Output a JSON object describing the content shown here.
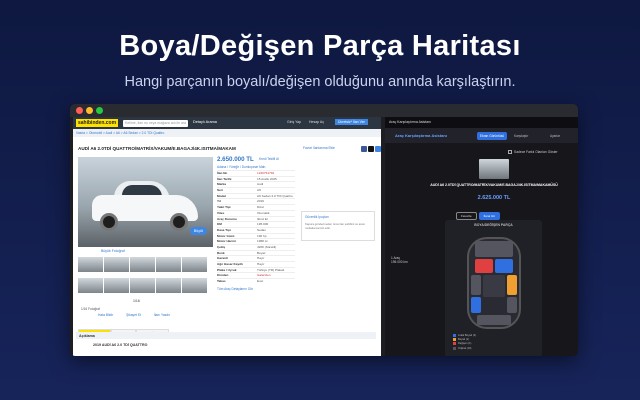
{
  "hero": {
    "title": "Boya/Değişen Parça Haritası",
    "subtitle": "Hangi parçanın boyalı/değişen olduğunu anında karşılaştırın."
  },
  "listing": {
    "logo": "sahibinden.com",
    "search_placeholder": "Kelime, ilan no veya mağaza adı ile ara",
    "detailed_search": "Detaylı Arama",
    "top_links": [
      "Giriş Yap",
      "Hesap Aç"
    ],
    "post_ad": "Ücretsiz* İlan Ver",
    "breadcrumb": "Vasıta > Otomobil > Audi > A6 > A6 Sedan > 2.0 TDI Quattro",
    "title": "AUDİ A6 2.0TDİ QUATTRO/MATRİX/VAKUM/E.BAGAJ/4K.ISITMA/MAKAM",
    "actions": "Favori İlanlarıma Ekle",
    "price": "2.650.000 TL",
    "price_link": "Kredi Teklifi Al",
    "location": "Adana / Yüreğir / Dumlupınar Mah.",
    "details": [
      {
        "k": "İlan No",
        "v": "1240751792",
        "red": true
      },
      {
        "k": "İlan Tarihi",
        "v": "15 Aralık 2025"
      },
      {
        "k": "Marka",
        "v": "Audi"
      },
      {
        "k": "Seri",
        "v": "A6"
      },
      {
        "k": "Model",
        "v": "A6 Sedan 2.0 TDI Quattro"
      },
      {
        "k": "Yıl",
        "v": "2019"
      },
      {
        "k": "Yakıt Tipi",
        "v": "Dizel"
      },
      {
        "k": "Vites",
        "v": "Otomatik"
      },
      {
        "k": "Araç Durumu",
        "v": "İkinci El"
      },
      {
        "k": "KM",
        "v": "195.000"
      },
      {
        "k": "Kasa Tipi",
        "v": "Sedan"
      },
      {
        "k": "Motor Gücü",
        "v": "190 hp"
      },
      {
        "k": "Motor Hacmi",
        "v": "1968 cc"
      },
      {
        "k": "Çekiş",
        "v": "4WD (Sürekli)"
      },
      {
        "k": "Renk",
        "v": "Beyaz"
      },
      {
        "k": "Garanti",
        "v": "Hayır"
      },
      {
        "k": "Ağır Hasar Kayıtlı",
        "v": "Hayır"
      },
      {
        "k": "Plaka / Uyruk",
        "v": "Türkiye (TR) Plakalı"
      },
      {
        "k": "Kimden",
        "v": "Galeriden",
        "red": true
      },
      {
        "k": "Takas",
        "v": "Evet"
      }
    ],
    "more_link": "Tüm Araç Detaylarını Gör",
    "expand": "Büyük Fotoğraf",
    "zoom_btn": "Büyüt",
    "pager": "1/16",
    "big_label": "1/16 Fotoğraf",
    "action_links": [
      "Hata Bildir",
      "Şikayet Et",
      "İlanı Yazdır"
    ],
    "tabs": [
      "İlan Detayları",
      "Konumu",
      "Benzer İlanlar"
    ],
    "desc_header": "Açıklama",
    "desc_text": "2019 AUDİ A6 2.0 TDİ QUATTRO",
    "seller_card": "Güvenlik İpuçları",
    "seller_text": "Kapora göndermeden önce ilan sahibini ve aracı mutlaka kontrol edin."
  },
  "extension": {
    "header": "Araç Karşılaştırma Asistanı",
    "title": "Araç Karşılaştırma Asistanı",
    "tabs": [
      "Ekran Görüntüsü",
      "Karşılaştır",
      "Ayarlar"
    ],
    "checkbox": "Sadece Farklı Olanları Göster",
    "car_title": "AUDİ A6 2.0TDİ QUATTRO/MATRİX/VAKUM/E.BAGAJ/4K.ISITMA/MAKAMÜSÜ",
    "price": "2.625.000 TL",
    "btn_fav": "Favorile",
    "btn_go": "İlana Git",
    "km_label": "1 Araç",
    "km_value": "195.000 km",
    "diagram_title": "BOYA/DEĞİŞEN PARÇA",
    "legend": [
      {
        "label": "Lokal Boyalı (2)",
        "color": "#2f6fe0"
      },
      {
        "label": "Boyalı (1)",
        "color": "#f0a030"
      },
      {
        "label": "Değişen (1)",
        "color": "#e04040"
      },
      {
        "label": "Orijinal (10)",
        "color": "#555560"
      }
    ]
  }
}
